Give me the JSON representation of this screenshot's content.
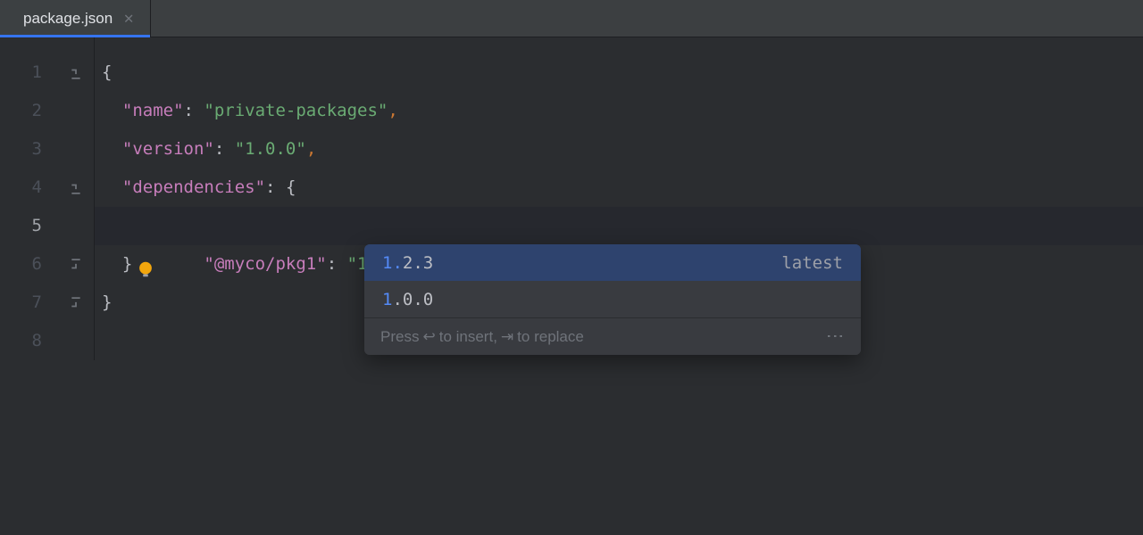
{
  "tab": {
    "filename": "package.json"
  },
  "gutter": {
    "lines": [
      "1",
      "2",
      "3",
      "4",
      "5",
      "6",
      "7",
      "8"
    ]
  },
  "code": {
    "line1_brace": "{",
    "line2_key": "\"name\"",
    "line2_colon": ": ",
    "line2_value": "\"private-packages\"",
    "line2_comma": ",",
    "line3_key": "\"version\"",
    "line3_colon": ": ",
    "line3_value": "\"1.0.0\"",
    "line3_comma": ",",
    "line4_key": "\"dependencies\"",
    "line4_colon": ": ",
    "line4_brace": "{",
    "line5_key": "\"@myco/pkg1\"",
    "line5_colon": ": ",
    "line5_value": "\"1.\"",
    "line6_brace": "}",
    "line7_brace": "}"
  },
  "completion": {
    "items": [
      {
        "match": "1.",
        "rest": "2.3",
        "hint": "latest"
      },
      {
        "match": "1",
        "rest": ".0.0",
        "hint": ""
      }
    ],
    "footer_pre": "Press ",
    "footer_mid": " to insert, ",
    "footer_post": " to replace"
  }
}
